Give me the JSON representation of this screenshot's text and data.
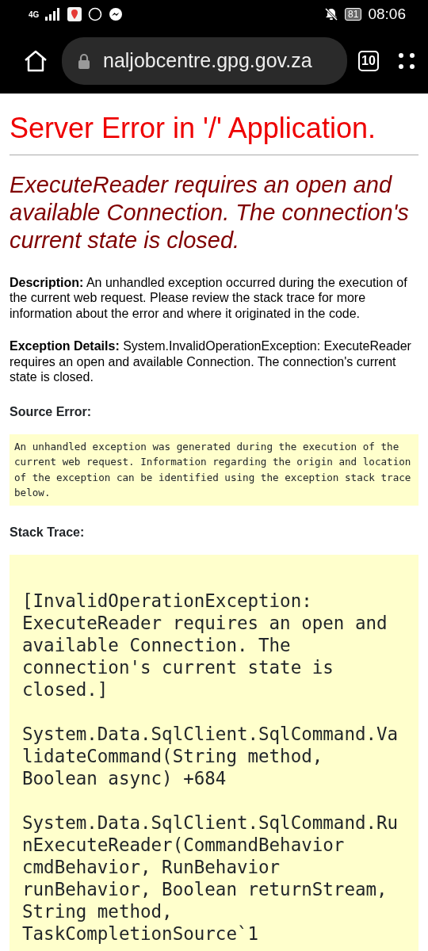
{
  "status_bar": {
    "network": "4G",
    "time": "08:06",
    "battery": "81"
  },
  "browser": {
    "url": "naljobcentre.gpg.gov.za",
    "tab_count": "10"
  },
  "page": {
    "title": "Server Error in '/' Application.",
    "error_heading": "ExecuteReader requires an open and available Connection. The connection's current state is closed.",
    "sections": [
      {
        "kind": "text",
        "label": "Description:",
        "text": "An unhandled exception occurred during the execution of the current web request. Please review the stack trace for more information about the error and where it originated in the code."
      },
      {
        "kind": "text",
        "label": "Exception Details:",
        "text": "System.InvalidOperationException: ExecuteReader requires an open and available Connection. The connection's current state is closed."
      },
      {
        "kind": "code",
        "label": "Source Error:",
        "lines": [
          "An unhandled exception was generated during the execution of the current web request. Information regarding the origin and location of the exception can be identified using the exception stack trace below."
        ]
      },
      {
        "kind": "stack",
        "label": "Stack Trace:",
        "lines": [
          "[InvalidOperationException: ExecuteReader requires an open and available Connection. The connection's current state is closed.]",
          "System.Data.SqlClient.SqlCommand.ValidateCommand(String method, Boolean async) +684",
          "System.Data.SqlClient.SqlCommand.RunExecuteReader(CommandBehavior cmdBehavior, RunBehavior runBehavior, Boolean returnStream, String method, TaskCompletionSource`1"
        ]
      }
    ]
  }
}
